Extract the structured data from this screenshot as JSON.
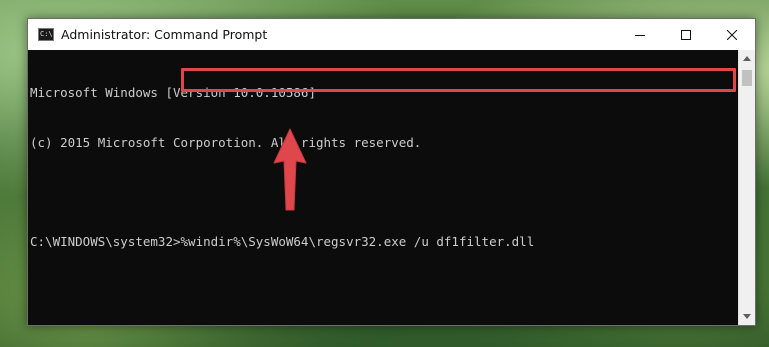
{
  "window": {
    "title": "Administrator: Command Prompt",
    "icon": "cmd-icon",
    "controls": [
      "minimize-icon",
      "maximize-icon",
      "close-icon"
    ]
  },
  "console": {
    "lines": [
      "Microsoft Windows [Version 10.0.10586]",
      "(c) 2015 Microsoft Corporotion. All rights reserved.",
      "",
      "C:\\WINDOWS\\system32>%windir%\\SysWoW64\\regsvr32.exe /u df1filter.dll"
    ],
    "background": "#0c0c0c",
    "foreground": "#cccccc"
  },
  "annotation": {
    "highlight_color": "#e0474c",
    "arrow_color": "#e0474c",
    "arrow_icon": "up-arrow-icon"
  }
}
